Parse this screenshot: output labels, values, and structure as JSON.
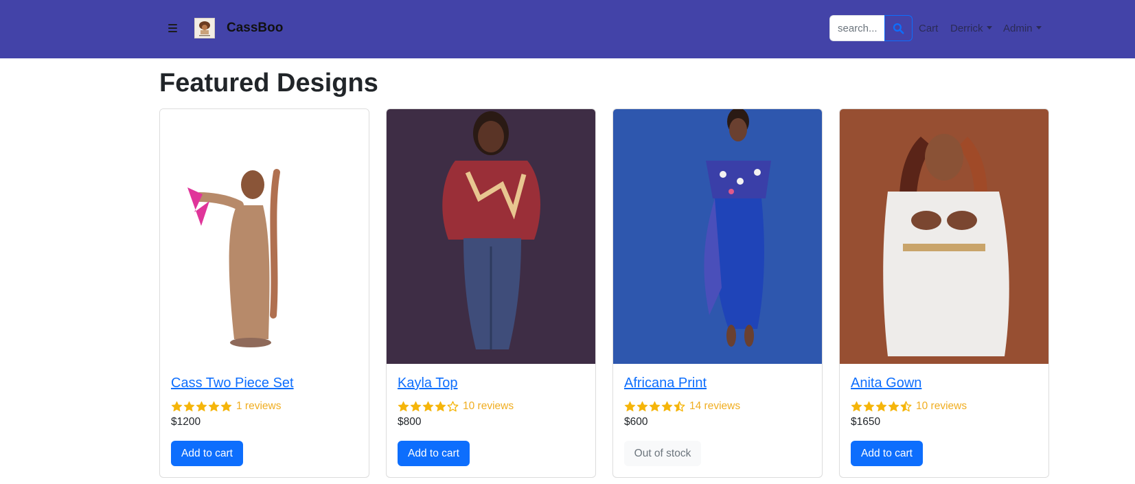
{
  "header": {
    "brand": "CassBoo",
    "search_placeholder": "search...",
    "cart_label": "Cart",
    "user_label": "Derrick",
    "admin_label": "Admin",
    "menu_icon": "hamburger-icon",
    "search_icon": "search-icon",
    "logo_icon": "brand-logo",
    "background_color": "#4343a8"
  },
  "main": {
    "title": "Featured Designs",
    "products": [
      {
        "name": "Cass Two Piece Set",
        "rating": 5,
        "reviews_label": "1 reviews",
        "price": "$1200",
        "button_label": "Add to cart",
        "in_stock": true
      },
      {
        "name": "Kayla Top",
        "rating": 4,
        "reviews_label": "10 reviews",
        "price": "$800",
        "button_label": "Add to cart",
        "in_stock": true
      },
      {
        "name": "Africana Print",
        "rating": 4.5,
        "reviews_label": "14 reviews",
        "price": "$600",
        "button_label": "Out of stock",
        "in_stock": false
      },
      {
        "name": "Anita Gown",
        "rating": 4.5,
        "reviews_label": "10 reviews",
        "price": "$1650",
        "button_label": "Add to cart",
        "in_stock": true
      }
    ]
  },
  "colors": {
    "primary": "#0d6efd",
    "star": "#f5b50a",
    "reviews_text": "#f0ad20"
  }
}
